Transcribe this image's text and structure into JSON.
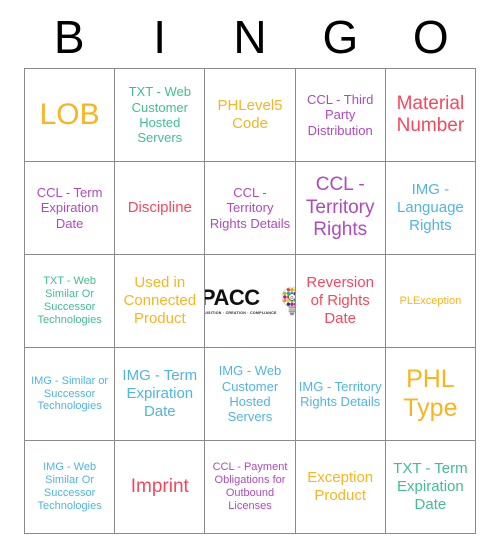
{
  "card": {
    "header_letters": [
      "B",
      "I",
      "N",
      "G",
      "O"
    ],
    "colors": {
      "orange": "#F7B521",
      "green": "#41BE91",
      "purple": "#AE4BBC",
      "red": "#F6485D",
      "blue": "#4FB6E0",
      "black": "#000000",
      "grid_line": "#8a8a8a",
      "background": "#FFFFFF"
    },
    "logo": {
      "name": "ipacc-logo",
      "wordmark": "IPACC",
      "tagline": "ACQUISITION  ·  CREATION  ·  COMPLIANCE",
      "icon": "lightbulb-icon"
    },
    "rows": [
      [
        {
          "text": "LOB",
          "color": "#F7B521",
          "size": "sz-xxl"
        },
        {
          "text": "TXT - Web Customer Hosted Servers",
          "color": "#41BE91",
          "size": "sz-s"
        },
        {
          "text": "PHLevel5 Code",
          "color": "#F7B521",
          "size": "sz-m"
        },
        {
          "text": "CCL - Third Party Distribution",
          "color": "#AE4BBC",
          "size": "sz-s"
        },
        {
          "text": "Material Number",
          "color": "#F6485D",
          "size": "sz-l"
        }
      ],
      [
        {
          "text": "CCL - Term Expiration Date",
          "color": "#AE4BBC",
          "size": "sz-s"
        },
        {
          "text": "Discipline",
          "color": "#F6485D",
          "size": "sz-m"
        },
        {
          "text": "CCL - Territory Rights Details",
          "color": "#AE4BBC",
          "size": "sz-s"
        },
        {
          "text": "CCL - Territory Rights",
          "color": "#AE4BBC",
          "size": "sz-l"
        },
        {
          "text": "IMG - Language Rights",
          "color": "#4FB6E0",
          "size": "sz-m"
        }
      ],
      [
        {
          "text": "TXT - Web Similar Or Successor Technologies",
          "color": "#41BE91",
          "size": "sz-xs"
        },
        {
          "text": "Used in Connected Product",
          "color": "#F7B521",
          "size": "sz-m"
        },
        {
          "text": "",
          "color": "#000000",
          "size": "sz-m",
          "logo": true
        },
        {
          "text": "Reversion of Rights Date",
          "color": "#F6485D",
          "size": "sz-m"
        },
        {
          "text": "PLException",
          "color": "#F7B521",
          "size": "sz-xs"
        }
      ],
      [
        {
          "text": "IMG - Similar or Successor Technologies",
          "color": "#4FB6E0",
          "size": "sz-xs"
        },
        {
          "text": "IMG - Term Expiration Date",
          "color": "#4FB6E0",
          "size": "sz-m"
        },
        {
          "text": "IMG - Web Customer Hosted Servers",
          "color": "#4FB6E0",
          "size": "sz-s"
        },
        {
          "text": "IMG - Territory Rights Details",
          "color": "#4FB6E0",
          "size": "sz-s"
        },
        {
          "text": "PHL Type",
          "color": "#F7B521",
          "size": "sz-xl"
        }
      ],
      [
        {
          "text": "IMG - Web Similar Or Successor Technologies",
          "color": "#4FB6E0",
          "size": "sz-xs"
        },
        {
          "text": "Imprint",
          "color": "#F6485D",
          "size": "sz-l"
        },
        {
          "text": "CCL - Payment Obligations for Outbound Licenses",
          "color": "#AE4BBC",
          "size": "sz-xs"
        },
        {
          "text": "Exception Product",
          "color": "#F7B521",
          "size": "sz-m"
        },
        {
          "text": "TXT - Term Expiration Date",
          "color": "#41BE91",
          "size": "sz-m"
        }
      ]
    ]
  }
}
